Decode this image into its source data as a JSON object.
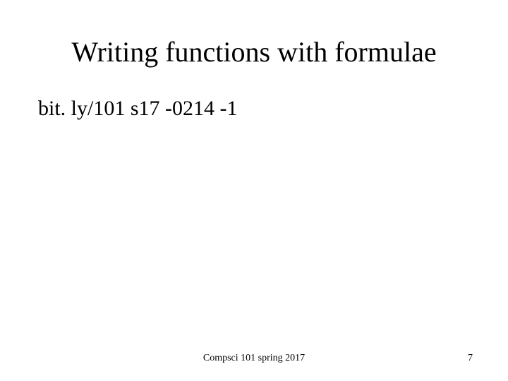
{
  "slide": {
    "title": "Writing functions with formulae",
    "body": "bit. ly/101 s17 -0214 -1",
    "footer": "Compsci 101 spring 2017",
    "page_number": "7"
  }
}
